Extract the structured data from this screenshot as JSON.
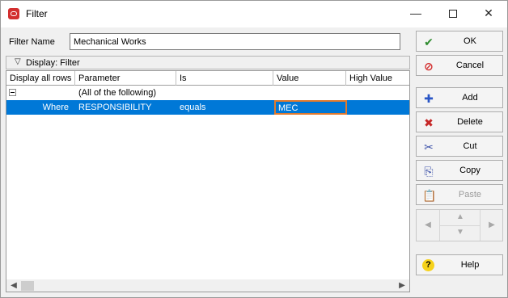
{
  "window": {
    "title": "Filter",
    "controls": {
      "minimize": "—",
      "close": "✕"
    }
  },
  "filter_name": {
    "label": "Filter Name",
    "value": "Mechanical Works"
  },
  "display_bar": {
    "label": "Display: Filter"
  },
  "grid": {
    "columns": [
      "Display all rows",
      "Parameter",
      "Is",
      "Value",
      "High Value"
    ],
    "rows": [
      {
        "display": "",
        "parameter": "(All of the following)",
        "is": "",
        "value": "",
        "high": ""
      },
      {
        "display": "Where",
        "parameter": "RESPONSIBILITY",
        "is": "equals",
        "value": "MEC",
        "high": ""
      }
    ]
  },
  "buttons": {
    "ok": "OK",
    "cancel": "Cancel",
    "add": "Add",
    "delete": "Delete",
    "cut": "Cut",
    "copy": "Copy",
    "paste": "Paste",
    "help": "Help"
  },
  "colors": {
    "selection": "#0078d7",
    "edit_border": "#e07a2e",
    "ok_green": "#2e8b2e",
    "cancel_red": "#d32f2f"
  }
}
